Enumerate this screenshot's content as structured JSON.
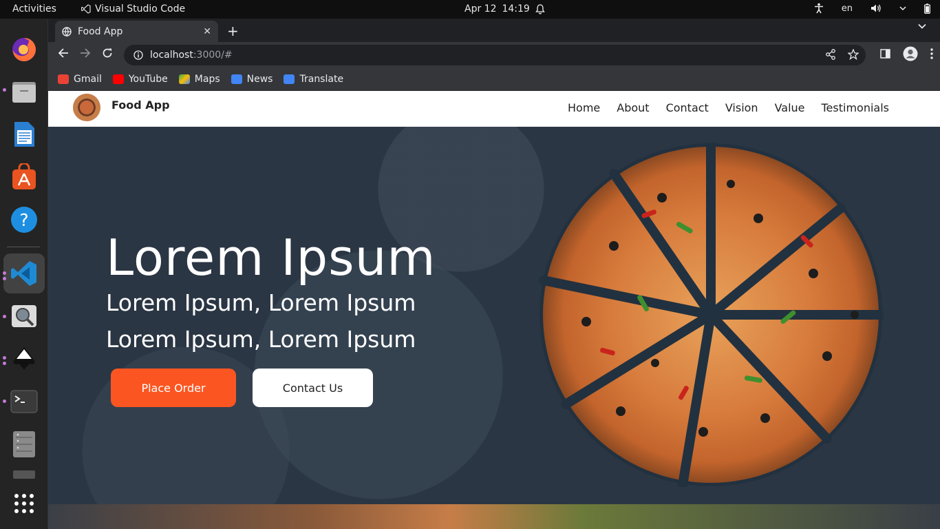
{
  "topbar": {
    "activities": "Activities",
    "app_name": "Visual Studio Code",
    "date": "Apr 12",
    "time": "14:19",
    "lang": "en"
  },
  "dock": {
    "items": [
      "firefox-icon",
      "files-icon",
      "writer-icon",
      "software-icon",
      "help-icon",
      "vscode-icon",
      "magnifier-icon",
      "inkscape-icon",
      "terminal-icon",
      "server-icon",
      "trash-icon",
      "apps-grid-icon"
    ]
  },
  "browser": {
    "tab_title": "Food App",
    "url_host": "localhost",
    "url_rest": ":3000/#",
    "bookmarks": [
      {
        "label": "Gmail",
        "color": "#ea4335"
      },
      {
        "label": "YouTube",
        "color": "#ff0000"
      },
      {
        "label": "Maps",
        "color": "#34a853"
      },
      {
        "label": "News",
        "color": "#4285f4"
      },
      {
        "label": "Translate",
        "color": "#4285f4"
      }
    ]
  },
  "site": {
    "brand": "Food App",
    "menu": [
      "Home",
      "About",
      "Contact",
      "Vision",
      "Value",
      "Testimonials"
    ],
    "hero": {
      "title": "Lorem Ipsum",
      "subtitle1": "Lorem Ipsum, Lorem Ipsum",
      "subtitle2": "Lorem Ipsum, Lorem Ipsum",
      "order_button": "Place Order",
      "contact_button": "Contact Us"
    },
    "colors": {
      "accent": "#fb5622",
      "hero_bg": "#2b3644"
    }
  }
}
